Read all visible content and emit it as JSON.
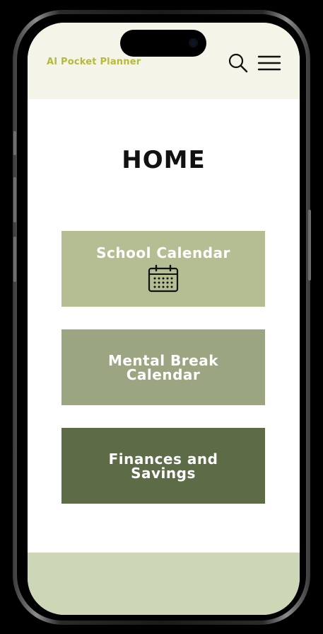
{
  "header": {
    "app_title": "AI Pocket Planner",
    "search_icon": "search-icon",
    "menu_icon": "hamburger-menu-icon"
  },
  "main": {
    "page_title": "HOME",
    "cards": [
      {
        "label": "School Calendar",
        "icon": "calendar-icon",
        "color": "#b5bd93"
      },
      {
        "label": "Mental Break\nCalendar",
        "color": "#9ba582"
      },
      {
        "label": "Finances and\nSavings",
        "color": "#5d6b47"
      }
    ]
  },
  "theme": {
    "header_bg": "#f4f4e8",
    "title_accent": "#b5ba3a",
    "footer_bg": "#ced6b8"
  }
}
